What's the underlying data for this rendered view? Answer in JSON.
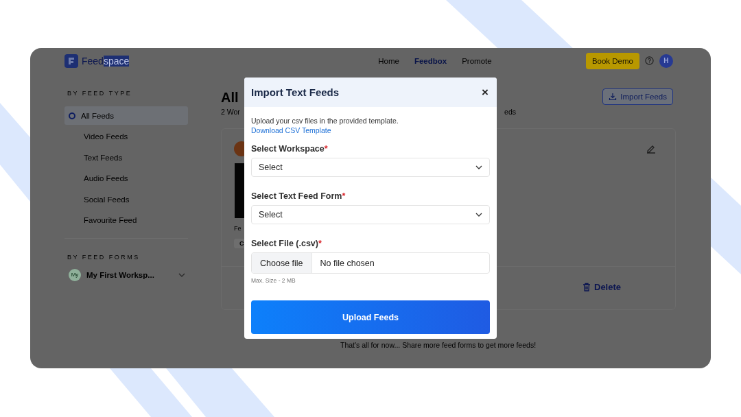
{
  "brand": {
    "name": "Feed",
    "highlight": "space"
  },
  "nav": [
    {
      "label": "Home",
      "selected": false
    },
    {
      "label": "Feedbox",
      "selected": true
    },
    {
      "label": "Promote",
      "selected": false
    }
  ],
  "book_demo": "Book Demo",
  "avatar": "H",
  "sidebar": {
    "type_heading": "BY FEED TYPE",
    "items": [
      {
        "label": "All Feeds",
        "selected": true
      },
      {
        "label": "Video Feeds",
        "selected": false
      },
      {
        "label": "Text Feeds",
        "selected": false
      },
      {
        "label": "Audio Feeds",
        "selected": false
      },
      {
        "label": "Social Feeds",
        "selected": false
      },
      {
        "label": "Favourite Feed",
        "selected": false
      }
    ],
    "forms_heading": "BY FEED FORMS",
    "workspace": {
      "badge": "My",
      "name": "My First Worksp...",
      "expanded": false
    }
  },
  "main": {
    "title": "All",
    "subtitle": "2 Wor",
    "subtitle_tail": "eds",
    "import_button": "Import Feeds",
    "card": {
      "form_label": "Fe",
      "chip": "C",
      "delete": "Delete"
    },
    "footer_note": "That's all for now... Share more feed forms to get more feeds!"
  },
  "modal": {
    "title": "Import Text Feeds",
    "close": "×",
    "description": "Upload your csv files in the provided template.",
    "link": "Download CSV Template",
    "fields": [
      {
        "kind": "select",
        "label": "Select Workspace",
        "required_mark": "*",
        "value": "Select"
      },
      {
        "kind": "select",
        "label": "Select Text Feed Form",
        "required_mark": "*",
        "value": "Select"
      },
      {
        "kind": "file",
        "label": "Select File (.csv)",
        "required_mark": "*",
        "button": "Choose file",
        "value": "No file chosen",
        "hint": "Max. Size - 2 MB"
      }
    ],
    "submit": "Upload Feeds"
  }
}
